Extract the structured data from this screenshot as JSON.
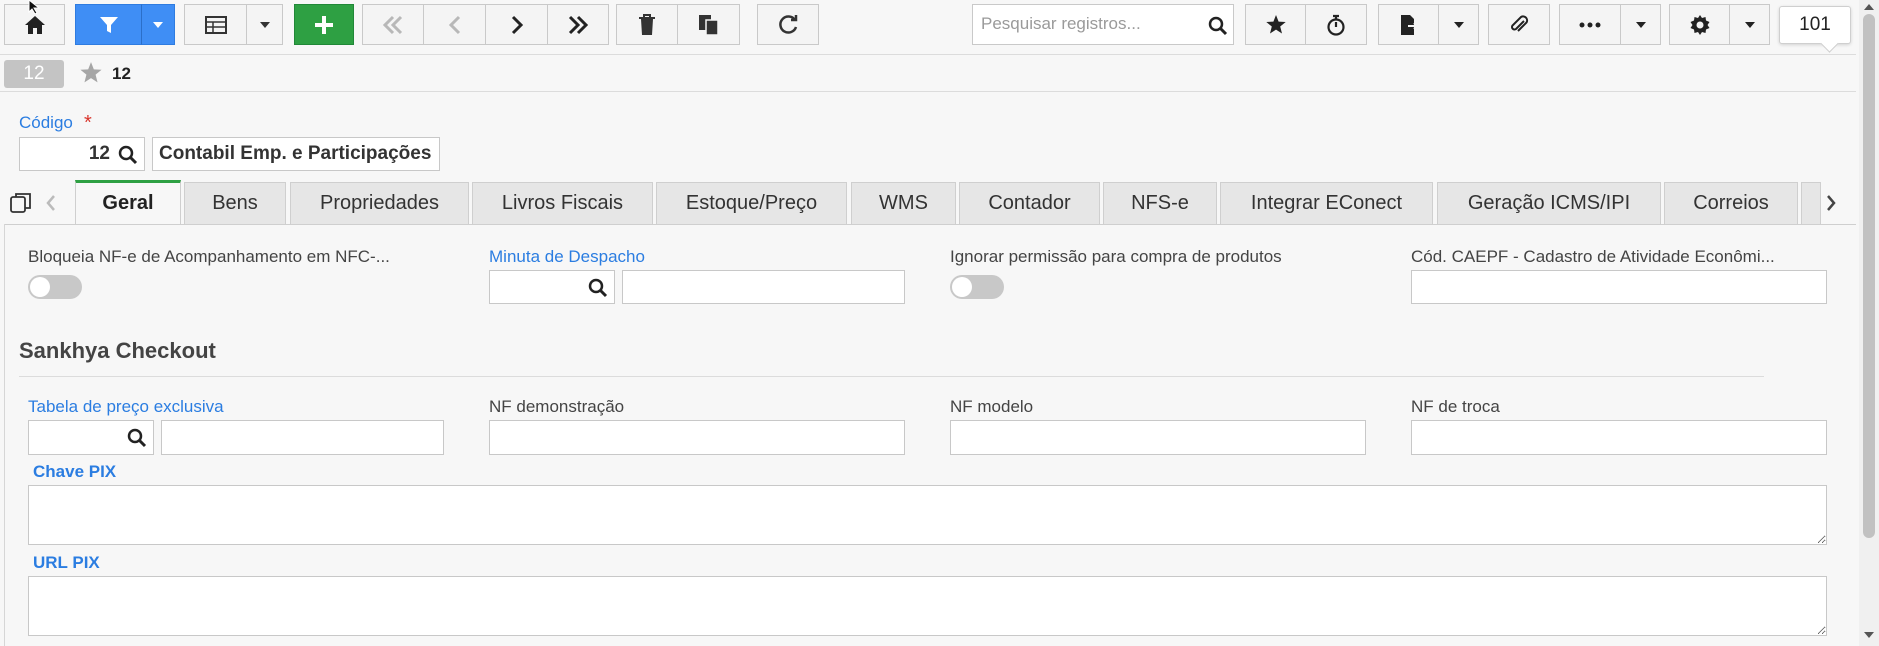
{
  "toolbar": {
    "search_placeholder": "Pesquisar registros...",
    "record_count": "101"
  },
  "record": {
    "badge": "12",
    "title": "12"
  },
  "header_form": {
    "code_label": "Código",
    "required_mark": "*",
    "code_value": "12",
    "name_value": "Contabil Emp. e Participações"
  },
  "tabs": [
    {
      "label": "Geral"
    },
    {
      "label": "Bens"
    },
    {
      "label": "Propriedades"
    },
    {
      "label": "Livros Fiscais"
    },
    {
      "label": "Estoque/Preço"
    },
    {
      "label": "WMS"
    },
    {
      "label": "Contador"
    },
    {
      "label": "NFS-e"
    },
    {
      "label": "Integrar EConect"
    },
    {
      "label": "Geração ICMS/IPI"
    },
    {
      "label": "Correios"
    }
  ],
  "fields": {
    "bloqueia_label": "Bloqueia NF-e de Acompanhamento em NFC-...",
    "minuta_label": "Minuta de Despacho",
    "ignorar_label": "Ignorar permissão para compra de produtos",
    "caepf_label": "Cód. CAEPF - Cadastro de Atividade Econômi..."
  },
  "checkout": {
    "section_title": "Sankhya Checkout",
    "tabela_label": "Tabela de preço exclusiva",
    "nf_demo_label": "NF demonstração",
    "nf_modelo_label": "NF modelo",
    "nf_troca_label": "NF de troca",
    "chave_pix_label": "Chave PIX",
    "url_pix_label": "URL PIX"
  },
  "colors": {
    "accent_blue": "#3f8ef5",
    "add_green": "#2ea043",
    "link_blue": "#2b7de1",
    "required_red": "#d9342b"
  }
}
